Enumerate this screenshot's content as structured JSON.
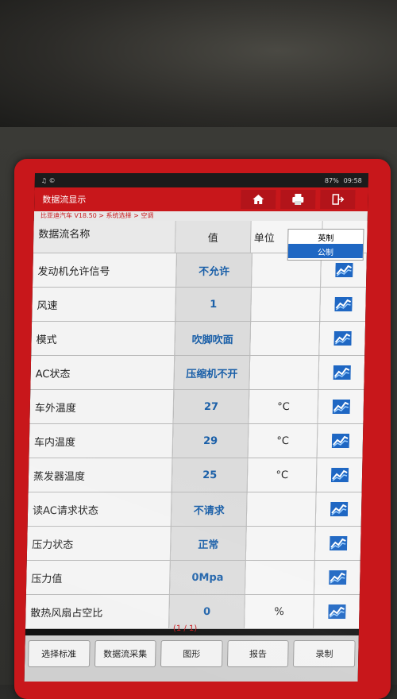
{
  "status_bar": {
    "left_icons": "♫ ©",
    "battery": "87%",
    "time": "09:58"
  },
  "header": {
    "title": "数据流显示",
    "home_icon": "home-icon",
    "print_icon": "print-icon",
    "exit_icon": "exit-icon"
  },
  "breadcrumb": "比亚迪汽车 V18.50 > 系统选择 > 空调",
  "table": {
    "columns": {
      "name": "数据流名称",
      "value": "值",
      "unit": "单位"
    },
    "rows": [
      {
        "name": "发动机允许信号",
        "value": "不允许",
        "unit": ""
      },
      {
        "name": "风速",
        "value": "1",
        "unit": ""
      },
      {
        "name": "模式",
        "value": "吹脚吹面",
        "unit": ""
      },
      {
        "name": "AC状态",
        "value": "压缩机不开",
        "unit": ""
      },
      {
        "name": "车外温度",
        "value": "27",
        "unit": "°C"
      },
      {
        "name": "车内温度",
        "value": "29",
        "unit": "°C"
      },
      {
        "name": "蒸发器温度",
        "value": "25",
        "unit": "°C"
      },
      {
        "name": "读AC请求状态",
        "value": "不请求",
        "unit": ""
      },
      {
        "name": "压力状态",
        "value": "正常",
        "unit": ""
      },
      {
        "name": "压力值",
        "value": "0Mpa",
        "unit": ""
      },
      {
        "name": "散热风扇占空比",
        "value": "0",
        "unit": "%"
      }
    ]
  },
  "unit_popup": {
    "options": [
      "英制",
      "公制"
    ],
    "selected": "公制"
  },
  "page_indicator": "(1 / 1)",
  "buttons": {
    "select_std": "选择标准",
    "collect": "数据流采集",
    "graph": "图形",
    "report": "报告",
    "record": "录制"
  },
  "colors": {
    "frame": "#c8171b",
    "value_text": "#1a5fa8",
    "popup_selected": "#1f67c3"
  }
}
